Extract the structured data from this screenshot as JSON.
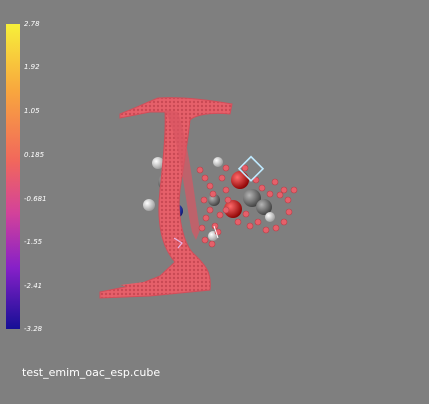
{
  "colorbar": {
    "ticks": [
      "2.78",
      "1.92",
      "1.05",
      "0.185",
      "-0.681",
      "-1.55",
      "-2.41",
      "-3.28"
    ],
    "gradient_colors": [
      "#f7f03a",
      "#f8a63e",
      "#f1675c",
      "#d3429a",
      "#8620c8",
      "#160f96"
    ]
  },
  "surface": {
    "color": "#e65a66"
  },
  "atoms": {
    "hydrogen": "#e6e6e6",
    "carbon": "#7a7a7a",
    "oxygen": "#e00000",
    "nitrogen": "#1a2acc"
  },
  "filename": "test_emim_oac_esp.cube"
}
